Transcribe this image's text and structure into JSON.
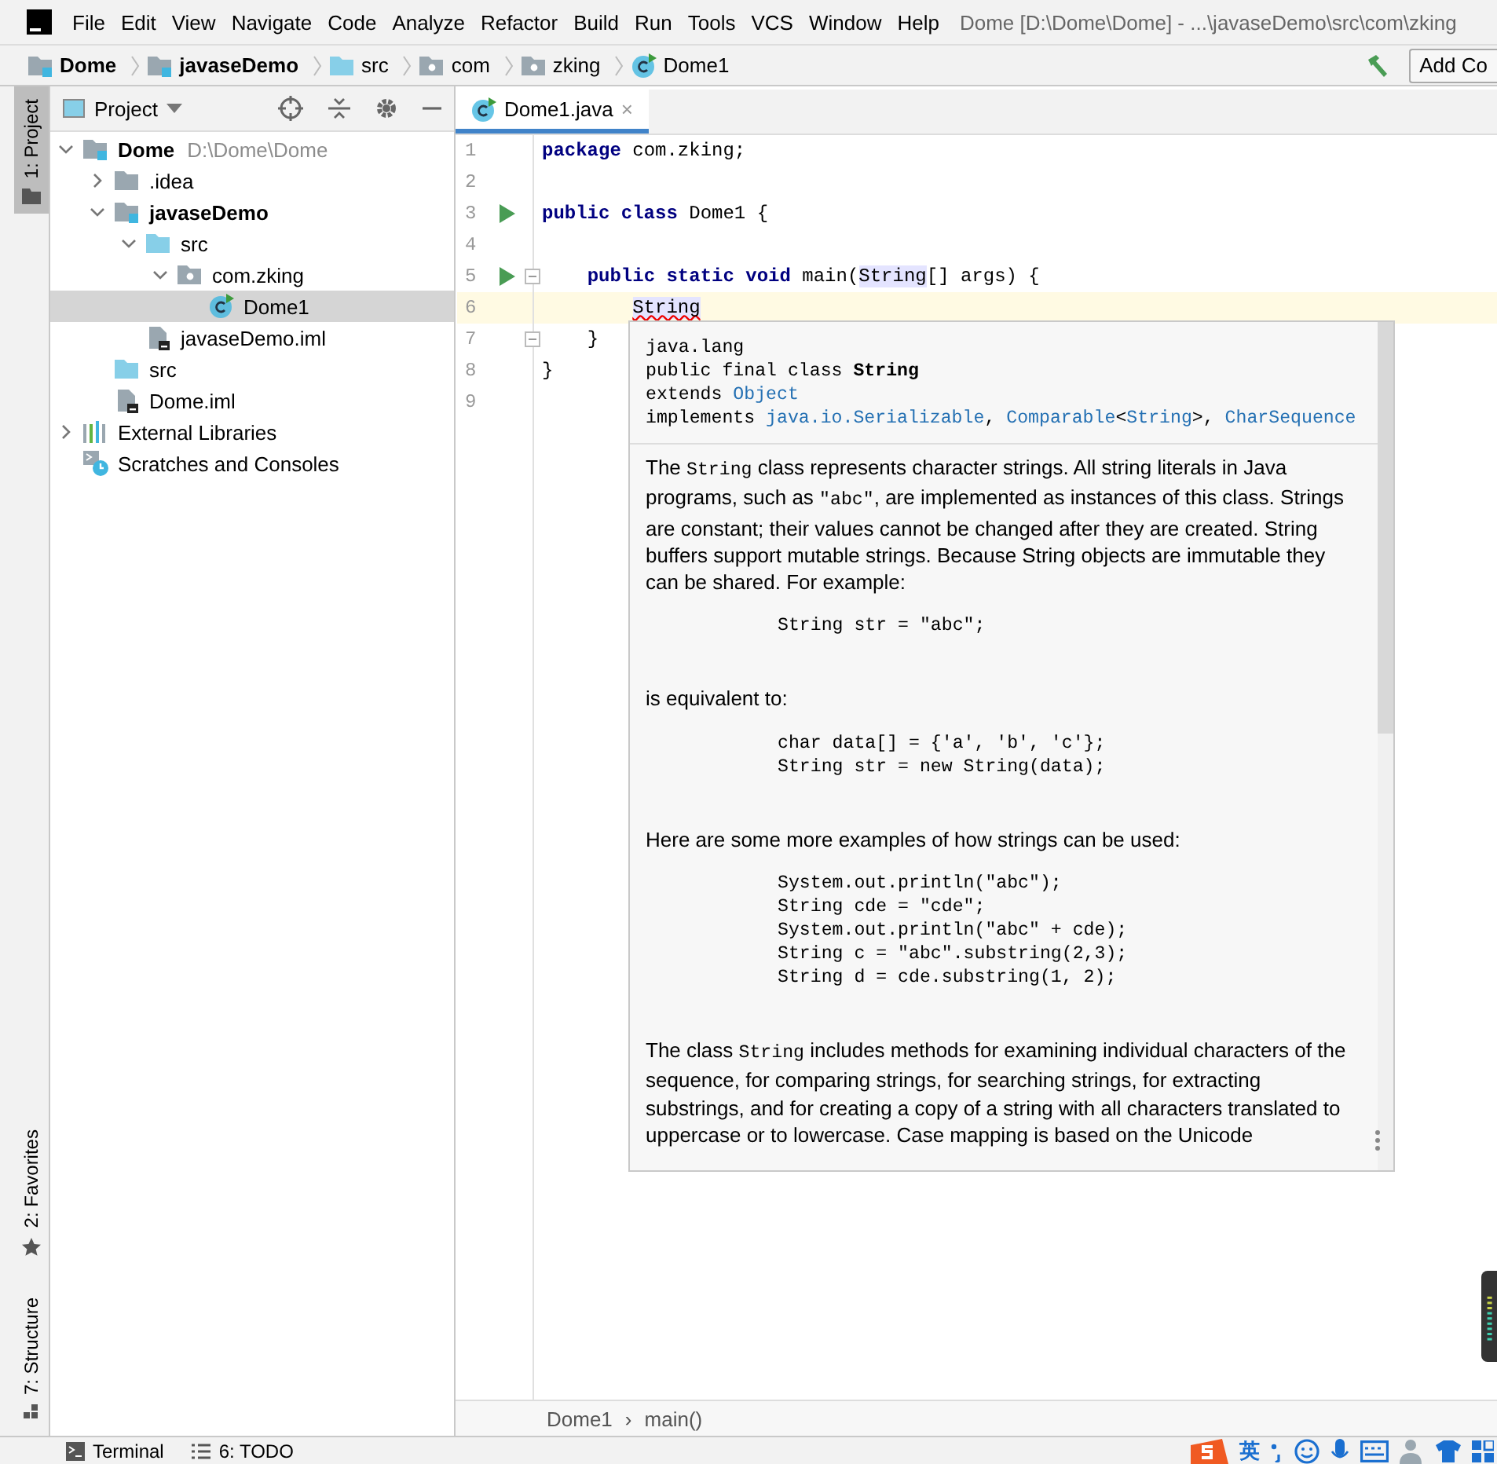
{
  "menu_bar": {
    "items": [
      "File",
      "Edit",
      "View",
      "Navigate",
      "Code",
      "Analyze",
      "Refactor",
      "Build",
      "Run",
      "Tools",
      "VCS",
      "Window",
      "Help"
    ],
    "title": "Dome [D:\\Dome\\Dome] - ...\\javaseDemo\\src\\com\\zking"
  },
  "nav_bar": {
    "crumbs": [
      {
        "label": "Dome",
        "kind": "module"
      },
      {
        "label": "javaseDemo",
        "kind": "module"
      },
      {
        "label": "src",
        "kind": "source-folder"
      },
      {
        "label": "com",
        "kind": "package"
      },
      {
        "label": "zking",
        "kind": "package"
      },
      {
        "label": "Dome1",
        "kind": "class"
      }
    ],
    "button": "Add Co"
  },
  "tool_stripe": {
    "top": [
      {
        "label": "1: Project",
        "selected": true
      }
    ],
    "bottom": [
      {
        "label": "2: Favorites",
        "selected": false
      },
      {
        "label": "7: Structure",
        "selected": false
      }
    ]
  },
  "project": {
    "title": "Project",
    "tree": [
      {
        "label": "Dome",
        "detail": "D:\\Dome\\Dome",
        "kind": "module",
        "expanded": true,
        "selected": false,
        "children": [
          {
            "label": ".idea",
            "kind": "folder",
            "expanded": false,
            "selected": false
          },
          {
            "label": "javaseDemo",
            "kind": "module",
            "expanded": true,
            "selected": false,
            "children": [
              {
                "label": "src",
                "kind": "source-folder",
                "expanded": true,
                "selected": false,
                "children": [
                  {
                    "label": "com.zking",
                    "kind": "package",
                    "expanded": true,
                    "selected": false,
                    "children": [
                      {
                        "label": "Dome1",
                        "kind": "class",
                        "selected": true
                      }
                    ]
                  }
                ]
              },
              {
                "label": "javaseDemo.iml",
                "kind": "iml",
                "selected": false
              }
            ]
          },
          {
            "label": "src",
            "kind": "source-folder",
            "selected": false
          },
          {
            "label": "Dome.iml",
            "kind": "iml",
            "selected": false
          }
        ]
      },
      {
        "label": "External Libraries",
        "kind": "libraries",
        "expanded": false,
        "selected": false
      },
      {
        "label": "Scratches and Consoles",
        "kind": "scratches",
        "selected": false
      }
    ]
  },
  "editor": {
    "tabs": [
      {
        "label": "Dome1.java",
        "close": "×",
        "selected": true
      }
    ],
    "lines": [
      {
        "number": "1",
        "run": false,
        "fold": false,
        "current": false,
        "tokens": [
          {
            "text": "package",
            "kind": "keyword"
          },
          {
            "text": " com.zking;",
            "kind": "plain"
          }
        ]
      },
      {
        "number": "2",
        "run": false,
        "fold": false,
        "current": false
      },
      {
        "number": "3",
        "run": true,
        "fold": false,
        "current": false,
        "tokens": [
          {
            "text": "public class",
            "kind": "keyword"
          },
          {
            "text": " Dome1 {",
            "kind": "plain"
          }
        ]
      },
      {
        "number": "4",
        "run": false,
        "fold": false,
        "current": false
      },
      {
        "number": "5",
        "run": true,
        "fold": true,
        "current": false,
        "tokens": [
          {
            "text": "    public static void",
            "kind": "keyword"
          },
          {
            "text": " main(",
            "kind": "plain"
          },
          {
            "text": "String",
            "kind": "usage"
          },
          {
            "text": "[] args) {",
            "kind": "plain"
          }
        ]
      },
      {
        "number": "6",
        "run": false,
        "fold": false,
        "current": true,
        "tokens": [
          {
            "text": "        String",
            "kind": "error"
          }
        ]
      },
      {
        "number": "7",
        "run": false,
        "fold": true,
        "current": false,
        "tokens": [
          {
            "text": "    }",
            "kind": "plain"
          }
        ]
      },
      {
        "number": "8",
        "run": false,
        "fold": false,
        "current": false,
        "tokens": [
          {
            "text": "}",
            "kind": "plain"
          }
        ]
      },
      {
        "number": "9",
        "run": false,
        "fold": false,
        "current": false
      }
    ],
    "breadcrumbs": [
      "Dome1",
      "main()"
    ],
    "breadcrumb_separator": "›"
  },
  "doc_popup": {
    "header": [
      [
        {
          "text": "java.lang",
          "kind": "plain"
        }
      ],
      [
        {
          "text": "public final class ",
          "kind": "plain"
        },
        {
          "text": "String",
          "kind": "bold"
        }
      ],
      [
        {
          "text": "extends ",
          "kind": "plain"
        },
        {
          "text": "Object",
          "kind": "link"
        }
      ],
      [
        {
          "text": "implements ",
          "kind": "plain"
        },
        {
          "text": "java.io.Serializable",
          "kind": "link"
        },
        {
          "text": ", ",
          "kind": "plain"
        },
        {
          "text": "Comparable",
          "kind": "link"
        },
        {
          "text": "<",
          "kind": "plain"
        },
        {
          "text": "String",
          "kind": "link"
        },
        {
          "text": ">, ",
          "kind": "plain"
        },
        {
          "text": "CharSequence",
          "kind": "link"
        }
      ]
    ],
    "body": [
      {
        "kind": "paragraph",
        "parts": [
          {
            "text": "The ",
            "kind": "plain"
          },
          {
            "text": "String",
            "kind": "code"
          },
          {
            "text": " class represents character strings. All string literals in Java programs, such as ",
            "kind": "plain"
          },
          {
            "text": "\"abc\"",
            "kind": "code"
          },
          {
            "text": ", are implemented as instances of this class. Strings are constant; their values cannot be changed after they are created. String buffers support mutable strings. Because String objects are immutable they can be shared. For example:",
            "kind": "plain"
          }
        ]
      },
      {
        "kind": "code",
        "lines": [
          "String str = \"abc\";"
        ]
      },
      {
        "kind": "paragraph",
        "parts": [
          {
            "text": "is equivalent to:",
            "kind": "plain"
          }
        ]
      },
      {
        "kind": "code",
        "lines": [
          "char data[] = {'a', 'b', 'c'};",
          "String str = new String(data);"
        ]
      },
      {
        "kind": "paragraph",
        "parts": [
          {
            "text": "Here are some more examples of how strings can be used:",
            "kind": "plain"
          }
        ]
      },
      {
        "kind": "code",
        "lines": [
          "System.out.println(\"abc\");",
          "String cde = \"cde\";",
          "System.out.println(\"abc\" + cde);",
          "String c = \"abc\".substring(2,3);",
          "String d = cde.substring(1, 2);"
        ]
      },
      {
        "kind": "paragraph",
        "parts": [
          {
            "text": "The class ",
            "kind": "plain"
          },
          {
            "text": "String",
            "kind": "code"
          },
          {
            "text": " includes methods for examining individual characters of the sequence, for comparing strings, for searching strings, for extracting substrings, and for creating a copy of a string with all characters translated to uppercase or to lowercase. Case mapping is based on the Unicode",
            "kind": "plain"
          }
        ]
      }
    ]
  },
  "bottom_bar": {
    "tools": [
      {
        "label": "Terminal",
        "kind": "terminal"
      },
      {
        "label": "6: TODO",
        "kind": "todo"
      }
    ],
    "ime_mode": "英"
  }
}
